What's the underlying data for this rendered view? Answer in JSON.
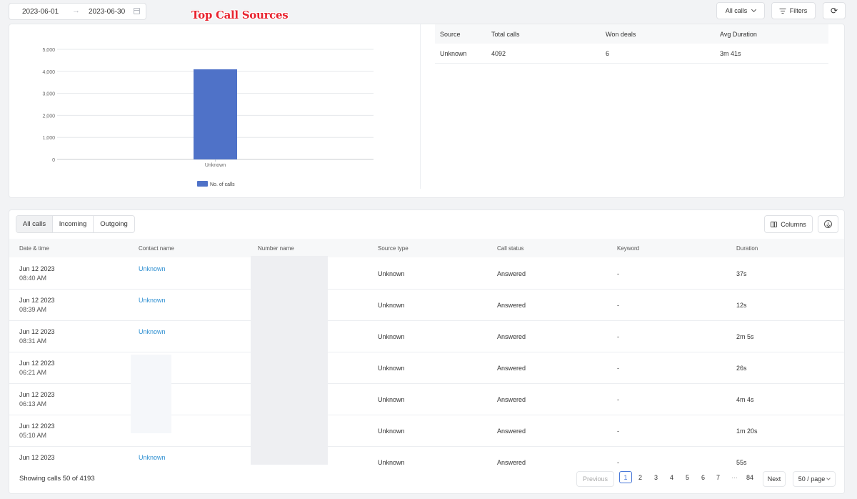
{
  "toolbar": {
    "date_start": "2023-06-01",
    "date_end": "2023-06-30",
    "all_calls_label": "All calls",
    "filters_label": "Filters"
  },
  "section_title": "Top Call Sources",
  "sources_table": {
    "headers": [
      "Source",
      "Total calls",
      "Won deals",
      "Avg Duration"
    ],
    "rows": [
      [
        "Unknown",
        "4092",
        "6",
        "3m 41s"
      ]
    ]
  },
  "chart_data": {
    "type": "bar",
    "categories": [
      "Unknown"
    ],
    "series": [
      {
        "name": "No. of calls",
        "values": [
          4092
        ],
        "color": "#4f72c8"
      }
    ],
    "yticks": [
      "0",
      "1,000",
      "2,000",
      "3,000",
      "4,000",
      "5,000"
    ],
    "ylim": [
      0,
      5000
    ],
    "title": "",
    "xlabel": "",
    "ylabel": "",
    "grid": true,
    "legend": "bottom"
  },
  "calls": {
    "tabs": [
      "All calls",
      "Incoming",
      "Outgoing"
    ],
    "active_tab": "All calls",
    "columns_label": "Columns",
    "headers": [
      "Date & time",
      "Contact name",
      "Number name",
      "Source type",
      "Call status",
      "Keyword",
      "Duration"
    ],
    "rows": [
      {
        "date": "Jun 12 2023",
        "time": "08:40 AM",
        "contact": "Unknown",
        "source": "Unknown",
        "status": "Answered",
        "keyword": "-",
        "duration": "37s"
      },
      {
        "date": "Jun 12 2023",
        "time": "08:39 AM",
        "contact": "Unknown",
        "source": "Unknown",
        "status": "Answered",
        "keyword": "-",
        "duration": "12s"
      },
      {
        "date": "Jun 12 2023",
        "time": "08:31 AM",
        "contact": "Unknown",
        "source": "Unknown",
        "status": "Answered",
        "keyword": "-",
        "duration": "2m 5s"
      },
      {
        "date": "Jun 12 2023",
        "time": "06:21 AM",
        "contact": "",
        "source": "Unknown",
        "status": "Answered",
        "keyword": "-",
        "duration": "26s"
      },
      {
        "date": "Jun 12 2023",
        "time": "06:13 AM",
        "contact": "",
        "source": "Unknown",
        "status": "Answered",
        "keyword": "-",
        "duration": "4m 4s"
      },
      {
        "date": "Jun 12 2023",
        "time": "05:10 AM",
        "contact": "",
        "source": "Unknown",
        "status": "Answered",
        "keyword": "-",
        "duration": "1m 20s"
      },
      {
        "date": "Jun 12 2023",
        "time": "",
        "contact": "Unknown",
        "source": "Unknown",
        "status": "Answered",
        "keyword": "-",
        "duration": "55s"
      }
    ],
    "showing_text": "Showing calls 50 of 4193"
  },
  "pagination": {
    "previous": "Previous",
    "pages": [
      "1",
      "2",
      "3",
      "4",
      "5",
      "6",
      "7",
      "···",
      "84"
    ],
    "current": "1",
    "next": "Next",
    "page_size": "50 / page"
  },
  "colors": {
    "accent": "#4a79d9",
    "bar": "#4f72c8",
    "link": "#2e8fd1",
    "title_overlay": "#e8232f"
  }
}
